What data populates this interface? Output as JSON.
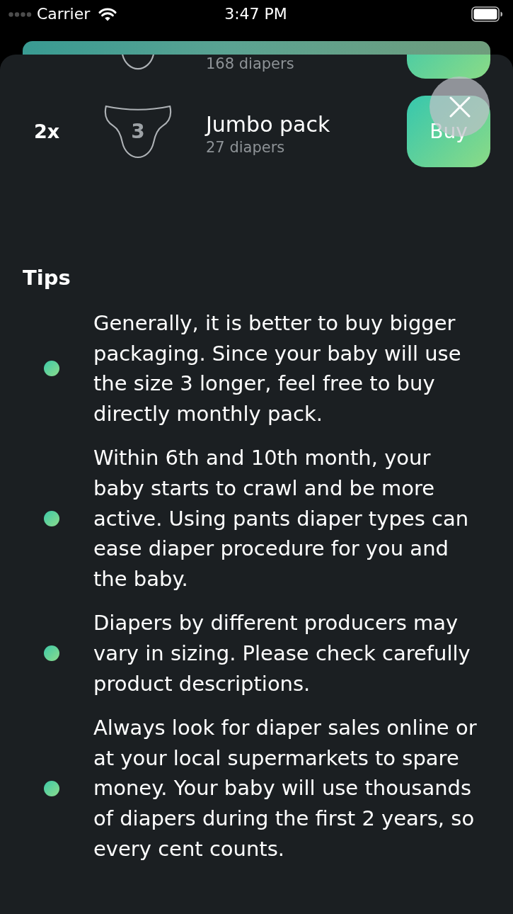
{
  "status_bar": {
    "carrier": "Carrier",
    "time": "3:47 PM"
  },
  "packs": [
    {
      "kind": "partial",
      "count": "168 diapers"
    },
    {
      "kind": "full",
      "quantity": "2x",
      "size": "3",
      "name": "Jumbo pack",
      "count": "27 diapers",
      "button": "Buy"
    }
  ],
  "tips": {
    "title": "Tips",
    "items": [
      "Generally, it is better to buy bigger packaging. Since your baby will use the size 3 longer, feel free to buy directly monthly pack.",
      "Within 6th and 10th month, your baby starts to crawl and be more active. Using pants diaper types can ease diaper procedure for you and the baby.",
      "Diapers by different producers may vary in sizing. Please check carefully product descriptions.",
      "Always look for diaper sales online or at your local supermarkets to spare money. Your baby will use thousands of diapers during the first 2 years, so every cent counts."
    ]
  }
}
